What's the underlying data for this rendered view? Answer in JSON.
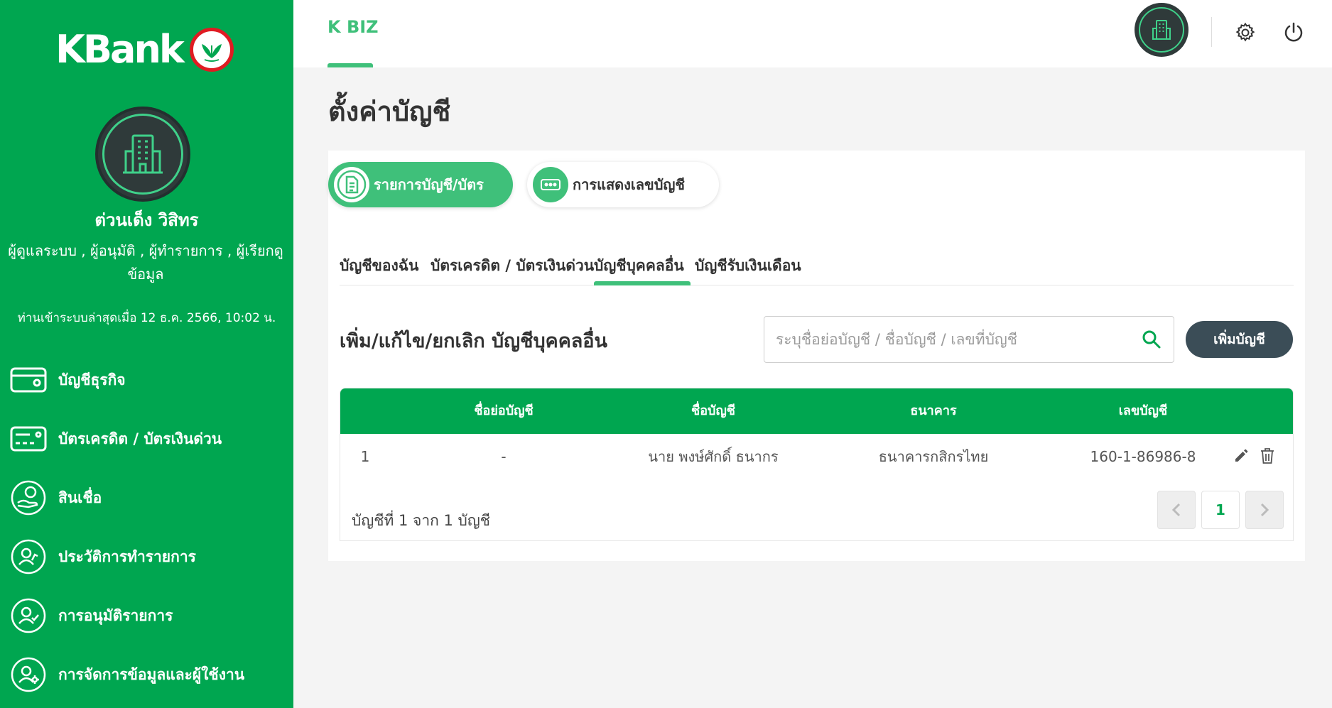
{
  "colors": {
    "primary": "#00a650",
    "accent": "#3fc07a",
    "dark_button": "#3b4d57",
    "logo_red": "#e01b22"
  },
  "sidebar": {
    "logo_text": "KBank",
    "user_name": "ต่วนเด็ง วิสิทร",
    "user_roles": "ผู้ดูแลระบบ , ผู้อนุมัติ , ผู้ทำรายการ , ผู้เรียกดูข้อมูล",
    "last_login": "ท่านเข้าระบบล่าสุดเมื่อ 12 ธ.ค. 2566, 10:02 น.",
    "menu": [
      {
        "label": "บัญชีธุรกิจ",
        "icon": "account-card-icon"
      },
      {
        "label": "บัตรเครดิต / บัตรเงินด่วน",
        "icon": "credit-card-icon"
      },
      {
        "label": "สินเชื่อ",
        "icon": "loan-hand-icon"
      },
      {
        "label": "ประวัติการทำรายการ",
        "icon": "transaction-history-icon"
      },
      {
        "label": "การอนุมัติรายการ",
        "icon": "approval-icon"
      },
      {
        "label": "การจัดการข้อมูลและผู้ใช้งาน",
        "icon": "user-management-icon"
      }
    ]
  },
  "header": {
    "brand_tab": "K BIZ",
    "icons": [
      "building-icon",
      "settings-icon",
      "power-icon"
    ]
  },
  "main": {
    "page_title": "ตั้งค่าบัญชี",
    "pills": [
      {
        "label": "รายการบัญชี/บัตร",
        "active": true,
        "icon": "document-icon"
      },
      {
        "label": "การแสดงเลขบัญชี",
        "active": false,
        "icon": "number-display-icon"
      }
    ],
    "subtabs": [
      {
        "label": "บัญชีของฉัน"
      },
      {
        "label": "บัตรเครดิต / บัตรเงินด่วน"
      },
      {
        "label": "บัญชีบุคคลอื่น"
      },
      {
        "label": "บัญชีรับเงินเดือน"
      }
    ],
    "active_subtab": "บัญชีบุคคลอื่น",
    "section_title": "เพิ่ม/แก้ไข/ยกเลิก บัญชีบุคคลอื่น",
    "search": {
      "placeholder": "ระบุชื่อย่อบัญชี / ชื่อบัญชี / เลขที่บัญชี",
      "value": ""
    },
    "add_button": "เพิ่มบัญชี",
    "table": {
      "headers": [
        "ชื่อย่อบัญชี",
        "ชื่อบัญชี",
        "ธนาคาร",
        "เลขบัญชี"
      ],
      "rows": [
        {
          "index": "1",
          "nickname": "-",
          "name": "นาย พงษ์ศักดิ์ ธนากร",
          "bank": "ธนาคารกสิกรไทย",
          "account_no": "160-1-86986-8"
        }
      ]
    },
    "count_text": "บัญชีที่ 1 จาก 1 บัญชี",
    "pagination": {
      "current_page": "1"
    }
  }
}
